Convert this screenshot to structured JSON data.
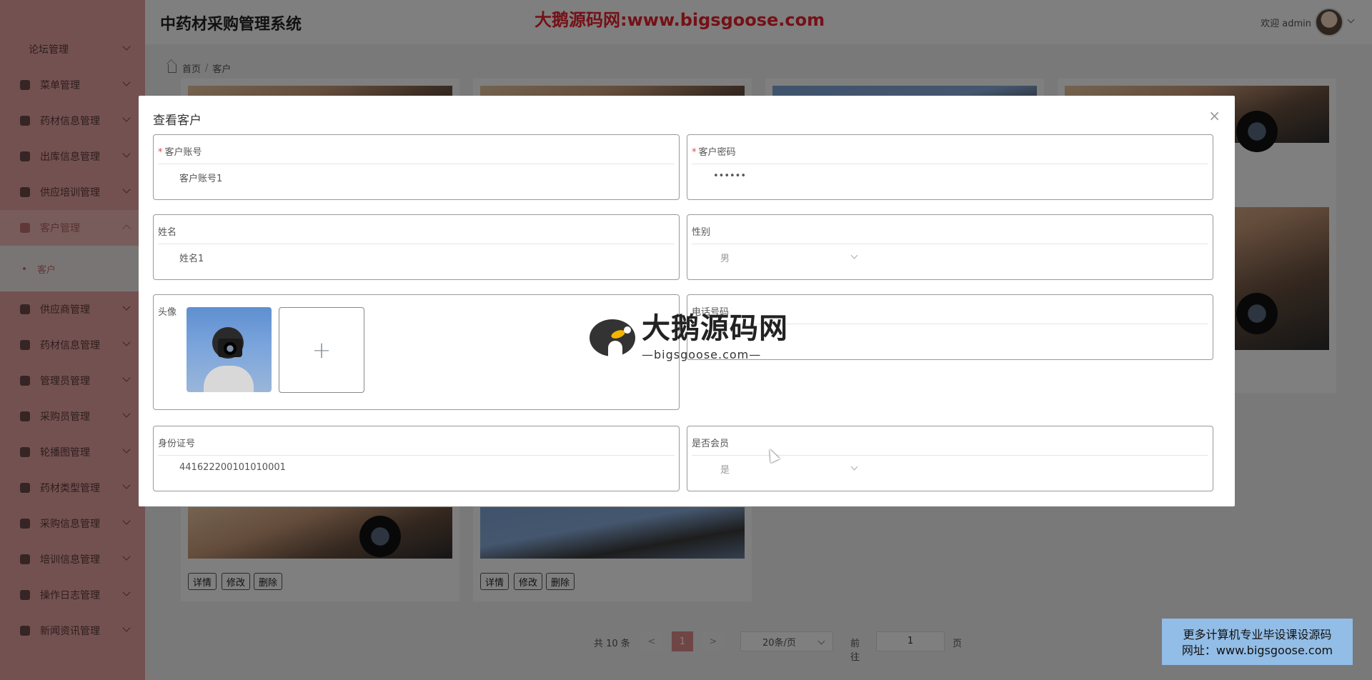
{
  "header": {
    "app_title": "中药材采购管理系统",
    "watermark_text": "大鹅源码网:www.bigsgoose.com",
    "welcome": "欢迎 admin"
  },
  "sidebar": {
    "items": [
      {
        "label": "论坛管理"
      },
      {
        "label": "菜单管理"
      },
      {
        "label": "药材信息管理"
      },
      {
        "label": "出库信息管理"
      },
      {
        "label": "供应培训管理"
      },
      {
        "label": "客户管理"
      },
      {
        "label": "客户"
      },
      {
        "label": "供应商管理"
      },
      {
        "label": "药材信息管理"
      },
      {
        "label": "管理员管理"
      },
      {
        "label": "采购员管理"
      },
      {
        "label": "轮播图管理"
      },
      {
        "label": "药材类型管理"
      },
      {
        "label": "采购信息管理"
      },
      {
        "label": "培训信息管理"
      },
      {
        "label": "操作日志管理"
      },
      {
        "label": "新闻资讯管理"
      }
    ]
  },
  "breadcrumb": {
    "home": "首页",
    "current": "客户"
  },
  "cards": {
    "detail_label": "详情",
    "edit_label": "修改",
    "delete_label": "删除"
  },
  "pagination": {
    "total": "共 10 条",
    "prev": "<",
    "current_page": "1",
    "next": ">",
    "page_size": "20条/页",
    "goto_label": "前往",
    "goto_value": "1",
    "page_suffix": "页"
  },
  "dialog": {
    "title": "查看客户",
    "close": "×",
    "fields": {
      "account": {
        "label": "客户账号",
        "value": "客户账号1"
      },
      "password": {
        "label": "客户密码",
        "value": "••••••"
      },
      "name": {
        "label": "姓名",
        "value": "姓名1"
      },
      "gender": {
        "label": "性别",
        "value": "男"
      },
      "avatar": {
        "label": "头像"
      },
      "phone": {
        "label": "电话号码",
        "value": ""
      },
      "id_card": {
        "label": "身份证号",
        "value": "441622200101010001"
      },
      "is_member": {
        "label": "是否会员",
        "value": "是"
      }
    },
    "upload_plus": "+"
  },
  "center_watermark": {
    "big": "大鹅源码网",
    "small": "—bigsgoose.com—"
  },
  "ad": {
    "line1": "更多计算机专业毕设课设源码",
    "line2": "网址：www.bigsgoose.com"
  }
}
